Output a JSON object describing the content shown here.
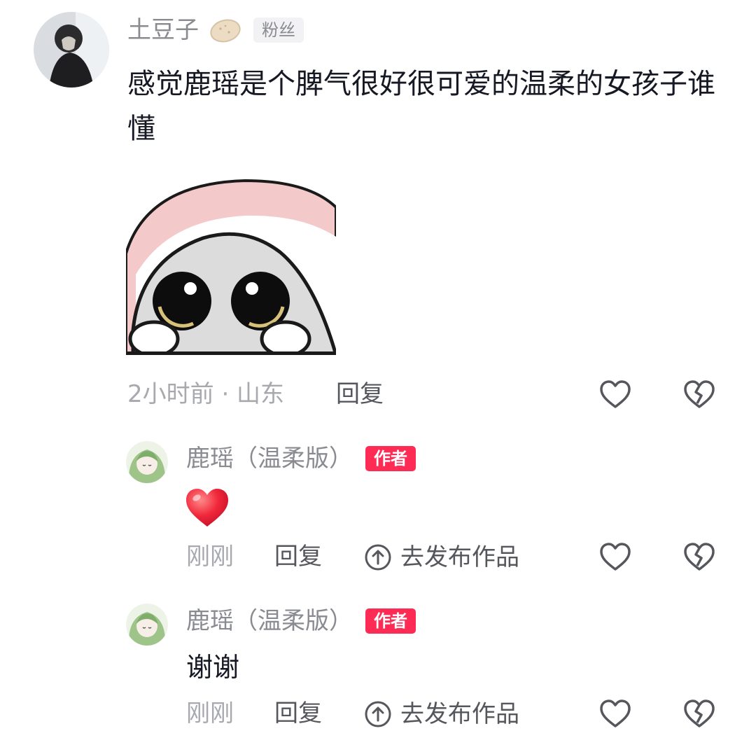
{
  "comment": {
    "username": "土豆子",
    "badge": "粉丝",
    "text": "感觉鹿瑶是个脾气很好很可爱的温柔的女孩子谁懂",
    "time_location": "2小时前 · 山东",
    "reply_label": "回复"
  },
  "replies": [
    {
      "name": "鹿瑶（温柔版）",
      "badge": "作者",
      "text": "",
      "time": "刚刚",
      "reply_label": "回复",
      "publish_label": "去发布作品"
    },
    {
      "name": "鹿瑶（温柔版）",
      "badge": "作者",
      "text": "谢谢",
      "time": "刚刚",
      "reply_label": "回复",
      "publish_label": "去发布作品"
    }
  ],
  "icons": {
    "like": "heart-outline-icon",
    "dislike": "broken-heart-icon",
    "potato": "potato-emoji-icon",
    "red_heart": "red-heart-emoji-icon",
    "publish": "up-arrow-circle-icon"
  },
  "colors": {
    "author_badge": "#fe2c55",
    "muted_text": "#a8a9ae",
    "name_text": "#8a8b91",
    "body_text": "#161823"
  }
}
